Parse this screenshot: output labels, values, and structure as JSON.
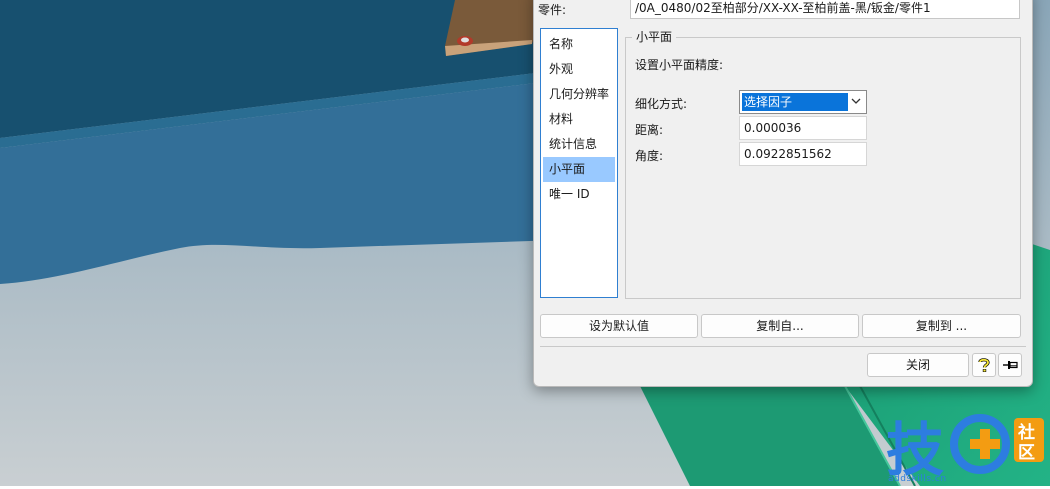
{
  "top_row": {
    "label": "零件:",
    "path": "/0A_0480/02至柏部分/XX-XX-至柏前盖-黑/钣金/零件1"
  },
  "nav": {
    "items": [
      {
        "label": "名称"
      },
      {
        "label": "外观"
      },
      {
        "label": "几何分辨率"
      },
      {
        "label": "材料"
      },
      {
        "label": "统计信息"
      },
      {
        "label": "小平面"
      },
      {
        "label": "唯一 ID"
      }
    ],
    "selected_index": 5
  },
  "panel": {
    "title": "小平面",
    "description": "设置小平面精度:",
    "method_label": "细化方式:",
    "method_value": "选择因子",
    "distance_label": "距离:",
    "distance_value": "0.000036",
    "angle_label": "角度:",
    "angle_value": "0.0922851562"
  },
  "buttons": {
    "set_default": "设为默认值",
    "copy_from": "复制自...",
    "copy_to": "复制到 ...",
    "close": "关闭"
  },
  "icons": {
    "help": "help-icon",
    "pin": "pin-icon",
    "dropdown": "chevron-down-icon"
  },
  "watermark": {
    "char1": "技",
    "char2": "社",
    "char3": "区",
    "url": "addskills.cn"
  },
  "colors": {
    "selection": "#99c9ff",
    "select_highlight": "#0a74da",
    "nav_border": "#2f7fd1",
    "watermark_blue": "#2d7de0",
    "watermark_orange": "#f39c12"
  }
}
